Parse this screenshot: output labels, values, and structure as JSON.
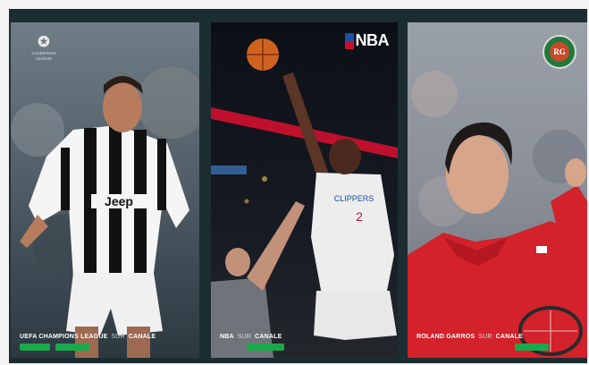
{
  "panels": [
    {
      "caption_title": "UEFA CHAMPIONS LEAGUE",
      "caption_suffix": "SUR",
      "caption_brand": "CANALE",
      "logo_lines": [
        "CHAMPIONS",
        "LEAGUE"
      ],
      "jersey_text": "Jeep"
    },
    {
      "caption_title": "NBA",
      "caption_suffix": "SUR",
      "caption_brand": "CANALE",
      "logo_text": "NBA",
      "jersey_text": "CLIPPERS",
      "jersey_number": "2"
    },
    {
      "caption_title": "ROLAND GARROS",
      "caption_suffix": "SUR",
      "caption_brand": "CANALE",
      "logo_text": "RG"
    }
  ],
  "colors": {
    "frame": "#1c2d31",
    "offer_green": "#1aa84b",
    "juve_black": "#111111",
    "clippers_red": "#c8102e",
    "djokovic_red": "#d3222b"
  }
}
